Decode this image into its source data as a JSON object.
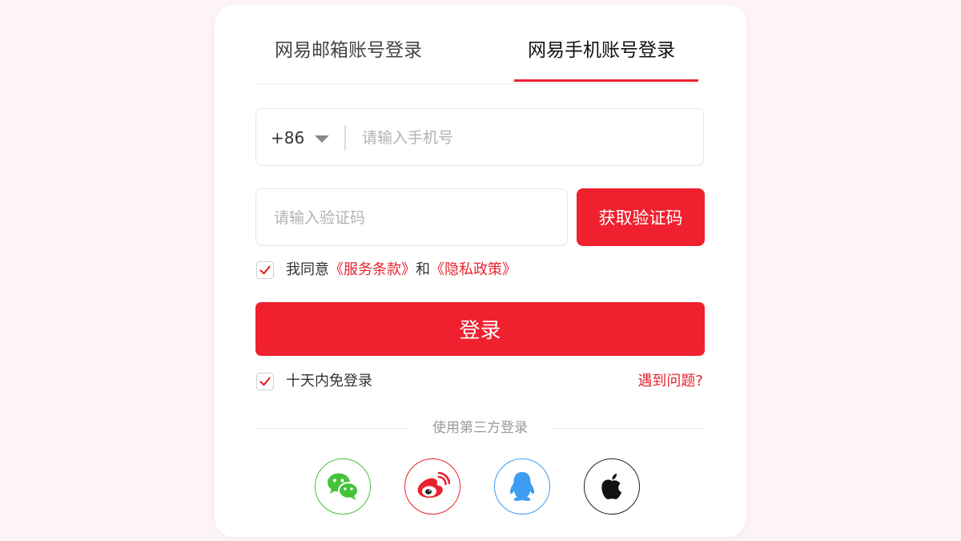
{
  "tabs": {
    "email_label": "网易邮箱账号登录",
    "phone_label": "网易手机账号登录",
    "active": "phone"
  },
  "phone": {
    "country_code": "+86",
    "placeholder": "请输入手机号",
    "value": ""
  },
  "code": {
    "placeholder": "请输入验证码",
    "value": "",
    "get_code_label": "获取验证码"
  },
  "agreement": {
    "checked": true,
    "prefix": "我同意",
    "terms_link": "《服务条款》",
    "conjunction": "和",
    "privacy_link": "《隐私政策》"
  },
  "login_button_label": "登录",
  "remember": {
    "checked": true,
    "label": "十天内免登录"
  },
  "help_link": "遇到问题?",
  "third_party": {
    "label": "使用第三方登录",
    "providers": [
      {
        "name": "wechat",
        "icon": "wechat-icon",
        "color": "#45c23a"
      },
      {
        "name": "weibo",
        "icon": "weibo-icon",
        "color": "#e8232f"
      },
      {
        "name": "qq",
        "icon": "qq-icon",
        "color": "#3e9cf2"
      },
      {
        "name": "apple",
        "icon": "apple-icon",
        "color": "#111111"
      }
    ]
  },
  "colors": {
    "accent": "#f1202e",
    "link": "#e8232f",
    "background": "#fcf4f5"
  }
}
